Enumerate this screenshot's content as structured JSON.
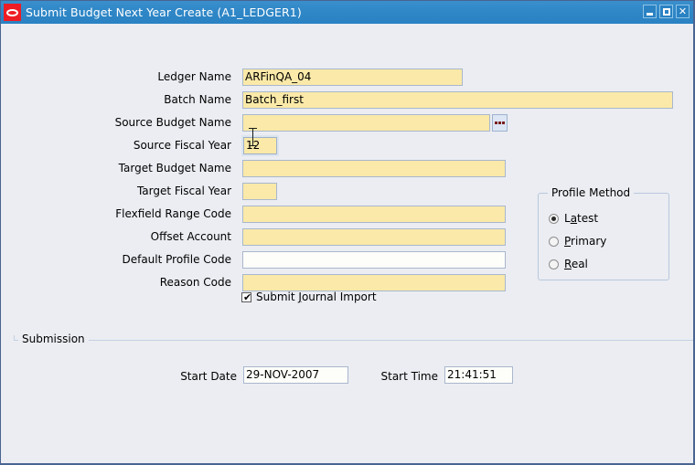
{
  "window": {
    "title": "Submit Budget Next Year Create (A1_LEDGER1)",
    "logo_icon": "oracle-logo-icon",
    "minimize_label": "_",
    "maximize_label": "□",
    "close_label": "✕",
    "background_color": "#ebedf2",
    "titlebar_color": "#2e86c6",
    "border_color": "#4a6491"
  },
  "form": {
    "required_field_color": "#fae9a8",
    "optional_field_color": "#fdfdfa",
    "fields": [
      {
        "label": "Ledger Name",
        "value": "ARFinQA_04",
        "required": true,
        "lov": false
      },
      {
        "label": "Batch Name",
        "value": "Batch_first",
        "required": true,
        "lov": false
      },
      {
        "label": "Source Budget Name",
        "value": "",
        "required": true,
        "lov": true
      },
      {
        "label": "Source Fiscal Year",
        "value": "12",
        "required": true,
        "lov": false
      },
      {
        "label": "Target Budget Name",
        "value": "",
        "required": true,
        "lov": false
      },
      {
        "label": "Target Fiscal Year",
        "value": "",
        "required": true,
        "lov": false
      },
      {
        "label": "Flexfield Range Code",
        "value": "",
        "required": true,
        "lov": false
      },
      {
        "label": "Offset Account",
        "value": "",
        "required": true,
        "lov": false
      },
      {
        "label": "Default Profile Code",
        "value": "",
        "required": false,
        "lov": false
      },
      {
        "label": "Reason Code",
        "value": "",
        "required": true,
        "lov": false
      }
    ],
    "checkbox": {
      "label": "Submit Journal Import",
      "mnemonic": "J",
      "checked": true,
      "check_glyph": "✔"
    }
  },
  "profile_method": {
    "title": "Profile Method",
    "options": [
      {
        "label": "Latest",
        "mnemonic": "a",
        "selected": true
      },
      {
        "label": "Primary",
        "mnemonic": "P",
        "selected": false
      },
      {
        "label": "Real",
        "mnemonic": "R",
        "selected": false
      }
    ]
  },
  "submission": {
    "title": "Submission",
    "start_date_label": "Start Date",
    "start_date_value": "29-NOV-2007",
    "start_time_label": "Start Time",
    "start_time_value": "21:41:51"
  }
}
